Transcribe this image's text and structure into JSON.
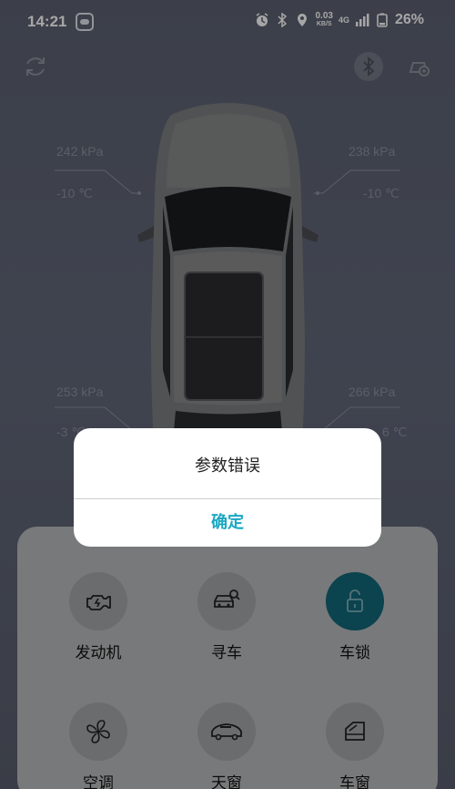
{
  "status_bar": {
    "time": "14:21",
    "net_speed_value": "0.03",
    "net_speed_unit": "KB/S",
    "network_type": "4G",
    "battery_percent": "26%"
  },
  "tires": {
    "front_left": {
      "pressure": "242 kPa",
      "temperature": "-10 ℃"
    },
    "front_right": {
      "pressure": "238 kPa",
      "temperature": "-10 ℃"
    },
    "rear_left": {
      "pressure": "253 kPa",
      "temperature": "-3 ℃"
    },
    "rear_right": {
      "pressure": "266 kPa",
      "temperature": "6 ℃"
    }
  },
  "controls": [
    {
      "label": "发动机",
      "icon": "engine-icon"
    },
    {
      "label": "寻车",
      "icon": "find-car-icon"
    },
    {
      "label": "车锁",
      "icon": "unlock-icon"
    },
    {
      "label": "空调",
      "icon": "fan-icon"
    },
    {
      "label": "天窗",
      "icon": "sunroof-icon"
    },
    {
      "label": "车窗",
      "icon": "window-icon"
    }
  ],
  "dialog": {
    "message": "参数错误",
    "confirm_label": "确定"
  },
  "colors": {
    "accent": "#1aa8c2",
    "lock_active": "#12677a"
  }
}
